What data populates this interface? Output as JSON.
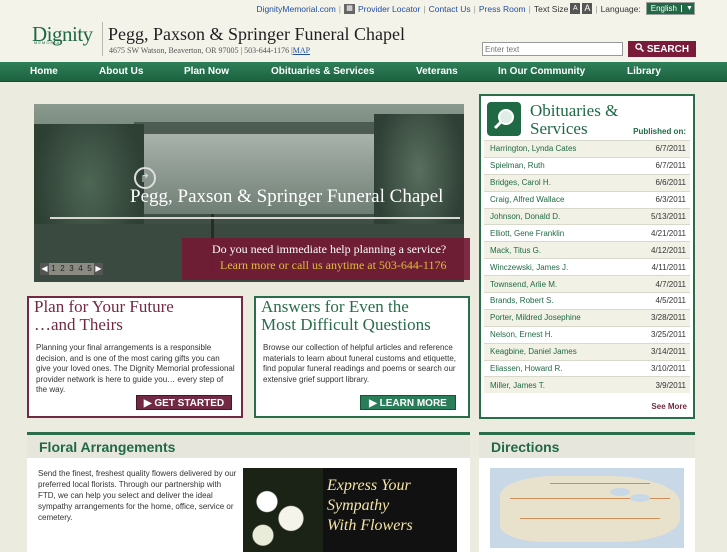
{
  "header": {
    "logo": "Dignity",
    "logo_sub": "MEMORIAL",
    "chapel_name": "Pegg, Paxson & Springer Funeral Chapel",
    "address": "4675 SW Watson, Beaverton, OR 97005 | 503-644-1176 |",
    "map_link": "MAP"
  },
  "toplinks": {
    "site": "DignityMemorial.com",
    "provider_locator": "Provider Locator",
    "contact": "Contact Us",
    "press_room": "Press Room",
    "text_size": "Text Size",
    "text_small": "A",
    "text_large": "A",
    "language_label": "Language:",
    "language_value": "English"
  },
  "search": {
    "placeholder": "Enter text",
    "button": "SEARCH"
  },
  "nav": [
    "Home",
    "About Us",
    "Plan Now",
    "Obituaries & Services",
    "Veterans",
    "In Our Community",
    "Library"
  ],
  "hero": {
    "title": "Pegg, Paxson & Springer Funeral Chapel",
    "question": "Do you need immediate help planning a service?",
    "call": "Learn more or call us anytime at 503-644-1176",
    "pager": [
      "1",
      "2",
      "3",
      "4",
      "5"
    ]
  },
  "plan": {
    "title_line1": "Plan for Your Future",
    "title_line2": "…and Theirs",
    "text": "Planning your final arrangements is a responsible decision, and is one of the most caring gifts you can give your loved ones. The Dignity Memorial professional provider network is here to guide you… every step of the way.",
    "button": "GET STARTED"
  },
  "answers": {
    "title_line1": "Answers for Even the",
    "title_line2": "Most Difficult Questions",
    "text": "Browse our collection of helpful articles and reference materials to learn about funeral customs and etiquette, find popular funeral readings and poems or search our extensive grief support library.",
    "button": "LEARN MORE"
  },
  "obituaries": {
    "title_line1": "Obituaries &",
    "title_line2": "Services",
    "published_label": "Published on:",
    "see_more": "See More",
    "items": [
      {
        "name": "Harrington, Lynda Cates",
        "date": "6/7/2011"
      },
      {
        "name": "Spielman, Ruth",
        "date": "6/7/2011"
      },
      {
        "name": "Bridges, Carol H.",
        "date": "6/6/2011"
      },
      {
        "name": "Craig, Alfred Wallace",
        "date": "6/3/2011"
      },
      {
        "name": "Johnson, Donald D.",
        "date": "5/13/2011"
      },
      {
        "name": "Elliott, Gene Franklin",
        "date": "4/21/2011"
      },
      {
        "name": "Mack, Titus G.",
        "date": "4/12/2011"
      },
      {
        "name": "Winczewski, James J.",
        "date": "4/11/2011"
      },
      {
        "name": "Townsend, Arlie M.",
        "date": "4/7/2011"
      },
      {
        "name": "Brands, Robert S.",
        "date": "4/5/2011"
      },
      {
        "name": "Porter, Mildred Josephine",
        "date": "3/28/2011"
      },
      {
        "name": "Nelson, Ernest H.",
        "date": "3/25/2011"
      },
      {
        "name": "Keagbine, Daniel James",
        "date": "3/14/2011"
      },
      {
        "name": "Eliassen, Howard R.",
        "date": "3/10/2011"
      },
      {
        "name": "Miller, James T.",
        "date": "3/9/2011"
      }
    ]
  },
  "floral": {
    "title": "Floral Arrangements",
    "text": "Send the finest, freshest quality flowers delivered by our preferred local florists. Through our partnership with FTD, we can help you select and deliver the ideal sympathy arrangements for the home, office, service or cemetery.",
    "promo_line1": "Express Your",
    "promo_line2": "Sympathy",
    "promo_line3": "With Flowers"
  },
  "directions": {
    "title": "Directions"
  },
  "colors": {
    "brand_green": "#1f6a45",
    "nav_green": "#2e8059",
    "accent_maroon": "#722a44",
    "gold": "#e3bc3a"
  },
  "icons": {
    "provider_locator": "map-icon",
    "obituaries": "magnifier-icon",
    "language_dropdown": "chevron-down-icon",
    "button_arrow": "triangle-right-icon"
  }
}
